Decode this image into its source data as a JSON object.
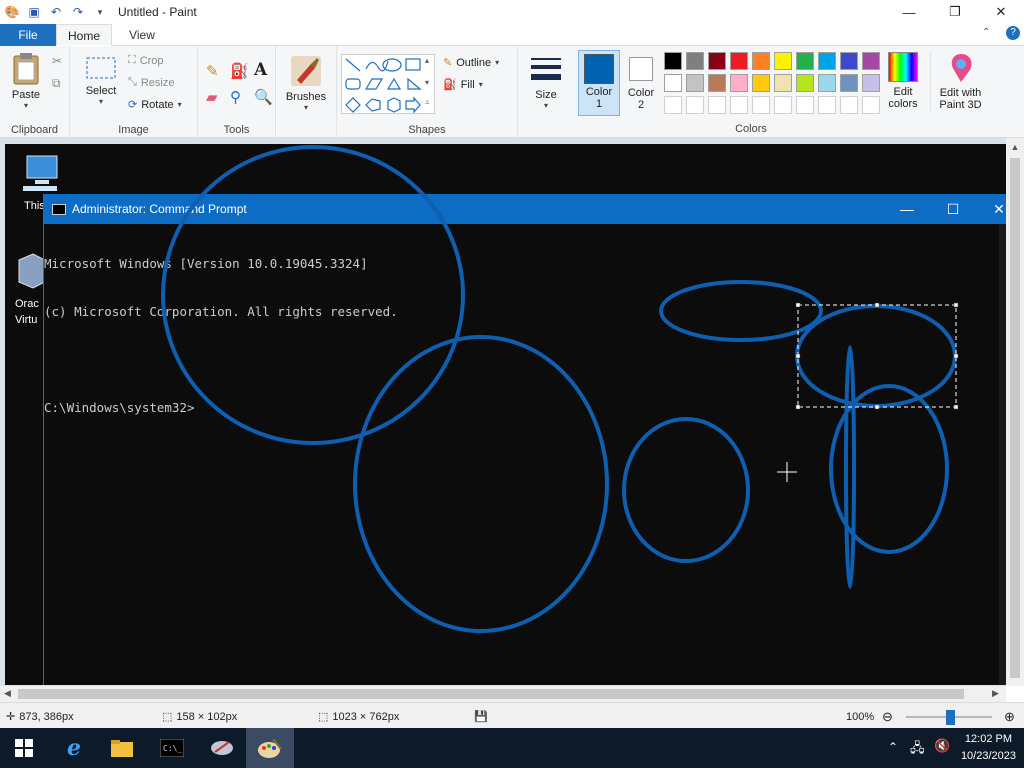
{
  "window": {
    "title": "Untitled - Paint"
  },
  "tabs": {
    "file": "File",
    "home": "Home",
    "view": "View"
  },
  "ribbon": {
    "clipboard": {
      "label": "Clipboard",
      "paste": "Paste"
    },
    "image": {
      "label": "Image",
      "select": "Select",
      "crop": "Crop",
      "resize": "Resize",
      "rotate": "Rotate"
    },
    "tools": {
      "label": "Tools"
    },
    "brushes": "Brushes",
    "shapes": {
      "label": "Shapes",
      "outline": "Outline",
      "fill": "Fill"
    },
    "size": "Size",
    "color1": [
      "Color",
      "1"
    ],
    "color2": [
      "Color",
      "2"
    ],
    "colors": {
      "label": "Colors",
      "edit": [
        "Edit",
        "colors"
      ]
    },
    "paint3d": [
      "Edit with",
      "Paint 3D"
    ],
    "palette_row1": [
      "#000000",
      "#7f7f7f",
      "#880015",
      "#ed1c24",
      "#ff7f27",
      "#fff200",
      "#22b14c",
      "#00a2e8",
      "#3f48cc",
      "#a349a4"
    ],
    "palette_row2": [
      "#ffffff",
      "#c3c3c3",
      "#b97a57",
      "#ffaec9",
      "#ffc90e",
      "#efe4b0",
      "#b5e61d",
      "#99d9ea",
      "#7092be",
      "#c8bfe7"
    ],
    "color1_value": "#0063b1",
    "color2_value": "#ffffff"
  },
  "canvas": {
    "desktop_icons": [
      "This",
      "Orac",
      "Virtu"
    ],
    "cmd": {
      "title": "Administrator: Command Prompt",
      "lines": [
        "Microsoft Windows [Version 10.0.19045.3324]",
        "(c) Microsoft Corporation. All rights reserved.",
        "",
        "C:\\Windows\\system32>"
      ]
    },
    "stroke_color": "#0f5fb0"
  },
  "status": {
    "cursor_pos": "873, 386px",
    "selection_size": "158 × 102px",
    "image_size": "1023 × 762px",
    "zoom": "100%"
  },
  "taskbar": {
    "time": "12:02 PM",
    "date": "10/23/2023"
  }
}
